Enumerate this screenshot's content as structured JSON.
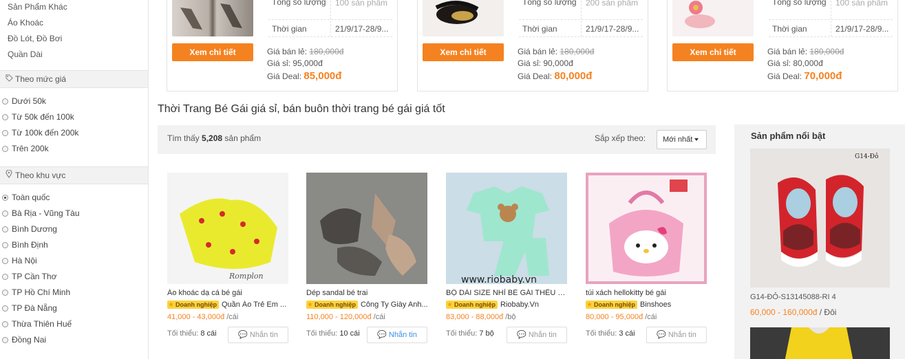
{
  "sidebar": {
    "category_links": [
      "Sản Phẩm Khác",
      "Áo Khoác",
      "Đồ Lót, Đồ Bơi",
      "Quần Dài"
    ],
    "price_heading": "Theo mức giá",
    "price_icon": "tag-icon",
    "price_options": [
      "Dưới 50k",
      "Từ 50k đến 100k",
      "Từ 100k đến 200k",
      "Trên 200k"
    ],
    "region_heading": "Theo khu vực",
    "region_icon": "map-pin-icon",
    "region_options": [
      "Toàn quốc",
      "Bà Rịa - Vũng Tàu",
      "Bình Dương",
      "Bình Định",
      "Hà Nội",
      "TP Cần Thơ",
      "TP Hồ Chí Minh",
      "TP Đà Nẵng",
      "Thừa Thiên Huế",
      "Đồng Nai"
    ],
    "region_selected": "Toàn quốc"
  },
  "deals": [
    {
      "button": "Xem chi tiết",
      "qty_label": "Tổng số lượng",
      "qty_value": "100 sản phẩm",
      "time_label": "Thời gian",
      "time_value": "21/9/17-28/9...",
      "retail_label": "Giá bán lẻ:",
      "retail_value": "180,000đ",
      "wholesale_label": "Giá sỉ:",
      "wholesale_value": "95,000đ",
      "deal_label": "Giá Deal:",
      "deal_value": "85,000đ"
    },
    {
      "button": "Xem chi tiết",
      "qty_label": "Tổng số lượng",
      "qty_value": "200 sản phẩm",
      "time_label": "Thời gian",
      "time_value": "21/9/17-28/9...",
      "retail_label": "Giá bán lẻ:",
      "retail_value": "180,000đ",
      "wholesale_label": "Giá sỉ:",
      "wholesale_value": "90,000đ",
      "deal_label": "Giá Deal:",
      "deal_value": "80,000đ"
    },
    {
      "button": "Xem chi tiết",
      "qty_label": "Tổng số lượng",
      "qty_value": "100 sản phẩm",
      "time_label": "Thời gian",
      "time_value": "21/9/17-28/9...",
      "retail_label": "Giá bán lẻ:",
      "retail_value": "180,000đ",
      "wholesale_label": "Giá sỉ:",
      "wholesale_value": "80,000đ",
      "deal_label": "Giá Deal:",
      "deal_value": "70,000đ"
    }
  ],
  "page_title": "Thời Trang Bé Gái giá sỉ, bán buôn thời trang bé gái giá tốt",
  "toolbar": {
    "found_prefix": "Tìm thấy",
    "found_count": "5,208",
    "found_suffix": "sản phẩm",
    "sort_label": "Sắp xếp theo:",
    "sort_value": "Mới nhất"
  },
  "products": [
    {
      "name": "Áo khoác dạ cá bé gái",
      "badge": "Doanh nghiệp",
      "seller": "Quần Áo Trẻ Em ...",
      "price": "41,000 - 43,000đ",
      "unit": "/cái",
      "moq_label": "Tối thiểu:",
      "moq_value": "8 cái",
      "message": "Nhắn tin"
    },
    {
      "name": "Dép sandal bé trai",
      "badge": "Doanh nghiệp",
      "seller": "Công Ty Giày Anh...",
      "price": "110,000 - 120,000đ",
      "unit": "/cái",
      "moq_label": "Tối thiểu:",
      "moq_value": "10 cái",
      "message": "Nhắn tin"
    },
    {
      "name": "BỘ DÀI SIZE NHỈ BÉ GÁI THÊU G...",
      "badge": "Doanh nghiệp",
      "seller": "Riobaby.Vn",
      "price": "83,000 - 88,000đ",
      "unit": "/bộ",
      "moq_label": "Tối thiểu:",
      "moq_value": "7 bộ",
      "message": "Nhắn tin",
      "watermark": "www.riobaby.vn"
    },
    {
      "name": "túi xách hellokitty bé gái",
      "badge": "Doanh nghiệp",
      "seller": "Binshoes",
      "price": "80,000 - 95,000đ",
      "unit": "/cái",
      "moq_label": "Tối thiểu:",
      "moq_value": "3 cái",
      "message": "Nhắn tin"
    }
  ],
  "featured": {
    "title": "Sản phẩm nổi bật",
    "item_name": "G14-ĐỎ-S13145088-RI 4",
    "item_price": "60,000 - 160,000đ",
    "item_unit": "/ Đôi",
    "image_tag": "G14-Đỏ"
  },
  "colors": {
    "accent": "#f58220",
    "badge": "#fbd33f",
    "link_blue": "#3a8ee6"
  }
}
